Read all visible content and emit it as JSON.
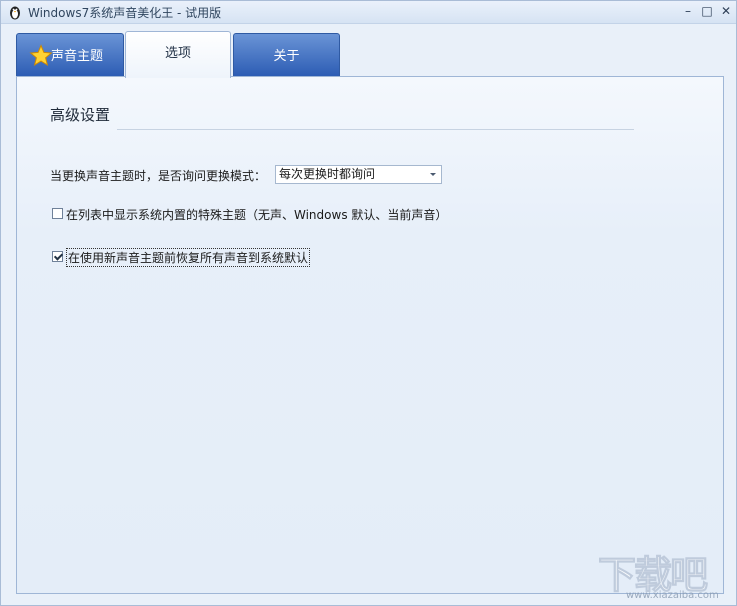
{
  "window": {
    "title": "Windows7系统声音美化王 - 试用版",
    "controls": {
      "minimize": "–",
      "maximize": "□",
      "close": "✕"
    }
  },
  "tabs": [
    {
      "label": "声音主题",
      "icon": "star-icon",
      "selected": false
    },
    {
      "label": "选项",
      "selected": true
    },
    {
      "label": "关于",
      "selected": false
    }
  ],
  "advanced": {
    "heading": "高级设置",
    "ask_mode_label": "当更换声音主题时，是否询问更换模式：",
    "ask_mode_value": "每次更换时都询问",
    "show_builtin_label": "在列表中显示系统内置的特殊主题（无声、Windows 默认、当前声音）",
    "show_builtin_checked": false,
    "restore_default_label": "在使用新声音主题前恢复所有声音到系统默认",
    "restore_default_checked": true
  },
  "watermark": {
    "main": "下载吧",
    "sub": "www.xiazaiba.com"
  },
  "colors": {
    "tab_blue": "#2b5bb3",
    "panel_bg": "#e7eff9"
  }
}
